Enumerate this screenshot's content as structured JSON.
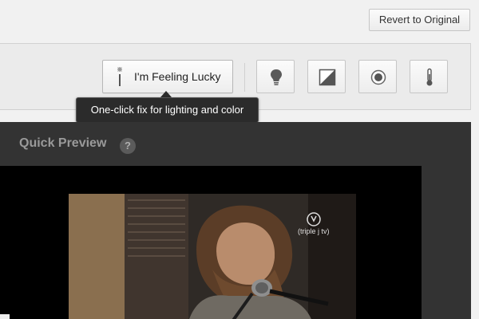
{
  "header": {
    "revert_label": "Revert to Original"
  },
  "toolbar": {
    "lucky_label": "I'm Feeling Lucky",
    "lucky_icon": "magic-wand-icon",
    "tools": [
      {
        "name": "lighting",
        "icon": "lightbulb-icon"
      },
      {
        "name": "contrast",
        "icon": "contrast-icon"
      },
      {
        "name": "saturation",
        "icon": "color-saturation-icon"
      },
      {
        "name": "temperature",
        "icon": "thermometer-icon"
      }
    ]
  },
  "tooltip": {
    "text": "One-click fix for lighting and color"
  },
  "preview": {
    "title": "Quick Preview",
    "help_glyph": "?",
    "watermark_text": "(triple j tv)"
  },
  "colors": {
    "page_background": "#f1f1f1",
    "toolbar_background": "#ebebeb",
    "panel_background": "#333333",
    "tooltip_background": "#2b2b2b",
    "video_background": "#000000"
  }
}
